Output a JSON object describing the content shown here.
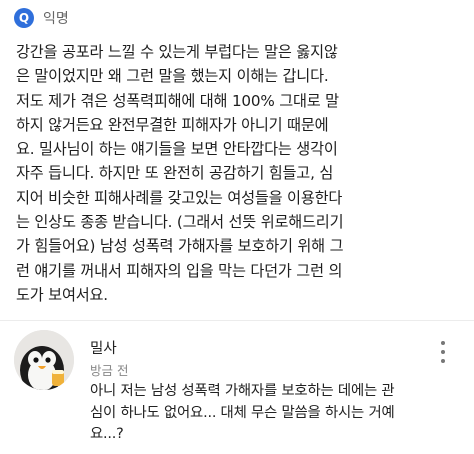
{
  "post": {
    "badge": "Q",
    "author": "익명",
    "body": "강간을 공포라 느낄 수 있는게 부럽다는 말은 옳지않\n은 말이었지만 왜 그런 말을 했는지 이해는 갑니다.\n저도 제가 겪은 성폭력피해에 대해 100% 그대로 말\n하지 않거든요 완전무결한 피해자가 아니기 때문에\n요. 밀사님이 하는 얘기들을 보면 안타깝다는 생각이\n자주 듭니다. 하지만 또 완전히 공감하기 힘들고, 심\n지어 비슷한 피해사례를 갖고있는 여성들을 이용한다\n는 인상도 종종 받습니다. (그래서 선뜻 위로해드리기\n가 힘들어요) 남성 성폭력 가해자를 보호하기 위해 그\n런 얘기를 꺼내서 피해자의 입을 막는 다던가 그런 의\n도가 보여서요."
  },
  "comment": {
    "author": "밀사",
    "time": "방금 전",
    "avatar_icon": "penguin-avatar-icon",
    "more_icon": "more-vertical-icon",
    "body": "아니 저는 남성 성폭력 가해자를 보호하는 데에는 관\n심이 하나도 없어요... 대체 무슨 말씀을 하시는 거예\n요...?"
  },
  "colors": {
    "badge": "#2f6fdb",
    "divider": "#ececec",
    "muted_text": "#888888"
  }
}
